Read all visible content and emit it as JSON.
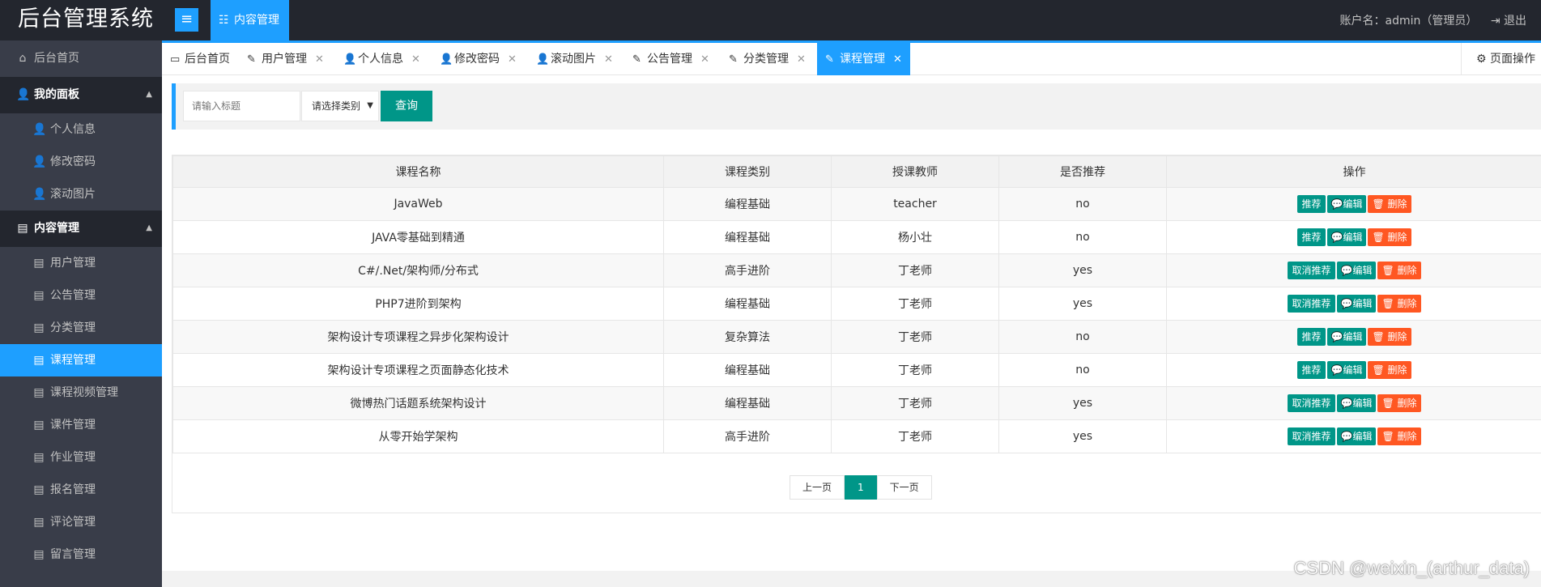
{
  "header": {
    "logo": "后台管理系统",
    "menu_toggle": "≡",
    "active_module": "内容管理",
    "account": "账户名：admin（管理员）",
    "logout": "退出"
  },
  "sidebar": {
    "home": "后台首页",
    "groups": [
      {
        "label": "我的面板",
        "items": [
          "个人信息",
          "修改密码",
          "滚动图片"
        ]
      },
      {
        "label": "内容管理",
        "items": [
          "用户管理",
          "公告管理",
          "分类管理",
          "课程管理",
          "课程视频管理",
          "课件管理",
          "作业管理",
          "报名管理",
          "评论管理",
          "留言管理"
        ]
      }
    ],
    "active_item": "课程管理"
  },
  "tabs": [
    {
      "label": "后台首页",
      "icon": "monitor-icon",
      "closable": false
    },
    {
      "label": "用户管理",
      "icon": "edit-icon",
      "closable": true
    },
    {
      "label": "个人信息",
      "icon": "user-icon",
      "closable": true
    },
    {
      "label": "修改密码",
      "icon": "user-lock-icon",
      "closable": true
    },
    {
      "label": "滚动图片",
      "icon": "user-lock-icon",
      "closable": true
    },
    {
      "label": "公告管理",
      "icon": "edit-icon",
      "closable": true
    },
    {
      "label": "分类管理",
      "icon": "edit-icon",
      "closable": true
    },
    {
      "label": "课程管理",
      "icon": "edit-icon",
      "closable": true,
      "active": true
    }
  ],
  "page_ops": "页面操作",
  "search": {
    "placeholder": "请输入标题",
    "category_placeholder": "请选择类别",
    "query": "查询"
  },
  "table": {
    "headers": [
      "课程名称",
      "课程类别",
      "授课教师",
      "是否推荐",
      "操作"
    ],
    "rows": [
      {
        "name": "JavaWeb",
        "category": "编程基础",
        "teacher": "teacher",
        "recommended": "no"
      },
      {
        "name": "JAVA零基础到精通",
        "category": "编程基础",
        "teacher": "杨小壮",
        "recommended": "no"
      },
      {
        "name": "C#/.Net/架构师/分布式",
        "category": "高手进阶",
        "teacher": "丁老师",
        "recommended": "yes"
      },
      {
        "name": "PHP7进阶到架构",
        "category": "编程基础",
        "teacher": "丁老师",
        "recommended": "yes"
      },
      {
        "name": "架构设计专项课程之异步化架构设计",
        "category": "复杂算法",
        "teacher": "丁老师",
        "recommended": "no"
      },
      {
        "name": "架构设计专项课程之页面静态化技术",
        "category": "编程基础",
        "teacher": "丁老师",
        "recommended": "no"
      },
      {
        "name": "微博热门话题系统架构设计",
        "category": "编程基础",
        "teacher": "丁老师",
        "recommended": "yes"
      },
      {
        "name": "从零开始学架构",
        "category": "高手进阶",
        "teacher": "丁老师",
        "recommended": "yes"
      }
    ],
    "ops": {
      "recommend": "推荐",
      "unrecommend": "取消推荐",
      "edit": "💬编辑",
      "delete": "🗑 删除"
    }
  },
  "pager": {
    "prev": "上一页",
    "current": "1",
    "next": "下一页"
  },
  "watermark": "CSDN @weixin_(arthur_data)",
  "colors": {
    "accent": "#1e9fff",
    "primary": "#009688",
    "danger": "#ff5722",
    "header_bg": "#23262e",
    "sidebar_bg": "#393d49"
  }
}
